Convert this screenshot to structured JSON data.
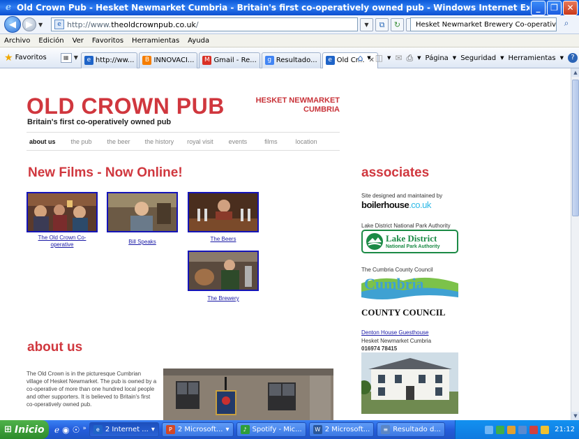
{
  "window": {
    "title": "Old Crown Pub - Hesket Newmarket Cumbria - Britain's first co-operatively owned pub - Windows Internet Explorer",
    "min_glyph": "_",
    "max_glyph": "❐",
    "close_glyph": "✕"
  },
  "address": {
    "url_prefix": "http://www.",
    "url_domain": "theoldcrownpub.co.uk",
    "url_suffix": "/",
    "search_text": "Hesket Newmarket Brewery Co-operative"
  },
  "menu": [
    "Archivo",
    "Edición",
    "Ver",
    "Favoritos",
    "Herramientas",
    "Ayuda"
  ],
  "favbar": {
    "favorites_label": "Favoritos",
    "tabs": [
      {
        "label": "http://ww...",
        "icon": "ie-icon",
        "color": "#1f64c8",
        "glyph": "e"
      },
      {
        "label": "INNOVACI...",
        "icon": "blogger-icon",
        "color": "#f57d00",
        "glyph": "B"
      },
      {
        "label": "Gmail - Re...",
        "icon": "gmail-icon",
        "color": "#d93025",
        "glyph": "M"
      },
      {
        "label": "Resultado...",
        "icon": "google-icon",
        "color": "#4285f4",
        "glyph": "g"
      },
      {
        "label": "Old Cr...",
        "icon": "ie-icon",
        "color": "#1f64c8",
        "glyph": "e"
      }
    ],
    "tab_close": "✕",
    "cmd": {
      "pagina": "Página",
      "seguridad": "Seguridad",
      "herramientas": "Herramientas"
    }
  },
  "site": {
    "logo": "OLD CROWN PUB",
    "tagline": "Britain's first co-operatively owned pub",
    "location_line1": "HESKET NEWMARKET",
    "location_line2": "CUMBRIA",
    "nav": [
      "about us",
      "the pub",
      "the beer",
      "the history",
      "royal visit",
      "events",
      "films",
      "location"
    ],
    "films_heading": "New Films - Now Online!",
    "films": [
      {
        "caption_line1": "The Old Crown Co-",
        "caption_line2": "operative"
      },
      {
        "caption_line1": "Bill Speaks"
      },
      {
        "caption_line1": "The Beers"
      },
      {
        "caption_line1": "The Brewery"
      }
    ],
    "about_heading": "about us",
    "about_text": "The Old Crown is in the picturesque Cumbrian village of Hesket Newmarket. The pub is owned by a co-operative of more than one hundred local people and other supporters. It is believed to Britain's first co-operatively owned pub.",
    "associates": {
      "heading": "associates",
      "boiler_caption": "Site designed and maintained by",
      "boiler_name": "boilerhouse",
      "boiler_tld": ".co.uk",
      "ldnp_caption": "Lake District National Park Authority",
      "ldnp_title": "Lake District",
      "ldnp_sub": "National Park Authority",
      "cumbria_caption": "The Cumbria County Council",
      "cumbria_logo_word": "Cumbria",
      "county_council": "COUNTY COUNCIL",
      "denton_link": "Denton House Guesthouse",
      "denton_place": "Hesket Newmarket Cumbria",
      "denton_phone": "016974 78415"
    }
  },
  "taskbar": {
    "start": "Inicio",
    "buttons": [
      {
        "label": "2 Internet ...",
        "icon": "ie-icon",
        "color": "#1f64c8",
        "glyph": "e"
      },
      {
        "label": "2 Microsoft...",
        "icon": "powerpoint-icon",
        "color": "#d24726",
        "glyph": "P"
      },
      {
        "label": "Spotify - Mic...",
        "icon": "spotify-icon",
        "color": "#2e9e3a",
        "glyph": "♪"
      },
      {
        "label": "2 Microsoft...",
        "icon": "word-icon",
        "color": "#2b579a",
        "glyph": "W"
      },
      {
        "label": "Resultado d...",
        "icon": "document-icon",
        "color": "#5a86c6",
        "glyph": "≡"
      }
    ],
    "clock": "21:12"
  }
}
